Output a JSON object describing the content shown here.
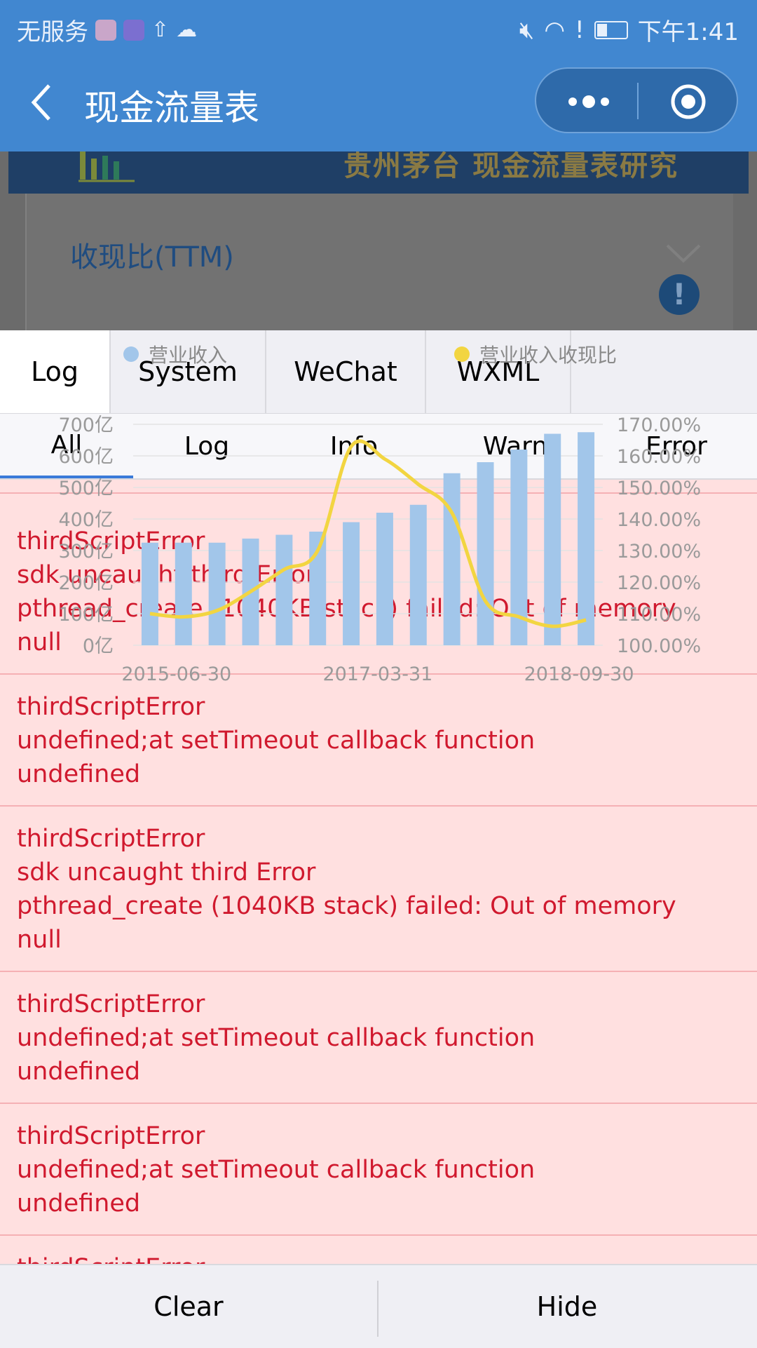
{
  "status_bar": {
    "carrier": "无服务",
    "time": "下午1:41"
  },
  "nav": {
    "title": "现金流量表"
  },
  "page": {
    "banner_text": "贵州茅台 现金流量表研究",
    "card_title": "收现比(TTM)"
  },
  "chart_data": {
    "type": "bar",
    "legend": [
      "营业收入",
      "营业收入收现比"
    ],
    "x_ticks": [
      "2015-06-30",
      "2017-03-31",
      "2018-09-30"
    ],
    "y_left_ticks": [
      "0亿",
      "100亿",
      "200亿",
      "300亿",
      "400亿",
      "500亿",
      "600亿",
      "700亿"
    ],
    "y_right_ticks": [
      "100.00%",
      "110.00%",
      "120.00%",
      "130.00%",
      "140.00%",
      "150.00%",
      "160.00%",
      "170.00%"
    ],
    "ylim_left": [
      0,
      700
    ],
    "ylim_right": [
      100,
      170
    ],
    "series": [
      {
        "name": "营业收入",
        "type": "bar",
        "color": "#a2c6ea",
        "values": [
          325,
          325,
          325,
          338,
          350,
          360,
          390,
          420,
          445,
          545,
          580,
          620,
          670,
          675
        ]
      },
      {
        "name": "营业收入收现比",
        "type": "line",
        "color": "#f2d541",
        "values": [
          110,
          109,
          111,
          117,
          124,
          130,
          163,
          159,
          151,
          142,
          114,
          109,
          106,
          108
        ]
      }
    ]
  },
  "tabs": [
    {
      "label": "Log",
      "active": true
    },
    {
      "label": "System"
    },
    {
      "label": "WeChat"
    },
    {
      "label": "WXML"
    }
  ],
  "filters": [
    {
      "label": "All",
      "active": true
    },
    {
      "label": "Log"
    },
    {
      "label": "Info"
    },
    {
      "label": "Warn"
    },
    {
      "label": "Error"
    }
  ],
  "logs": {
    "partial_line": "undefined",
    "entries": [
      [
        "thirdScriptError",
        "sdk uncaught third Error",
        "pthread_create (1040KB stack) failed: Out of memory",
        "null"
      ],
      [
        "thirdScriptError",
        "undefined;at setTimeout callback function",
        "undefined"
      ],
      [
        "thirdScriptError",
        "sdk uncaught third Error",
        "pthread_create (1040KB stack) failed: Out of memory",
        "null"
      ],
      [
        "thirdScriptError",
        "undefined;at setTimeout callback function",
        "undefined"
      ],
      [
        "thirdScriptError",
        "undefined;at setTimeout callback function",
        "undefined"
      ],
      [
        "thirdScriptError"
      ]
    ]
  },
  "bottom": {
    "clear_label": "Clear",
    "hide_label": "Hide"
  }
}
